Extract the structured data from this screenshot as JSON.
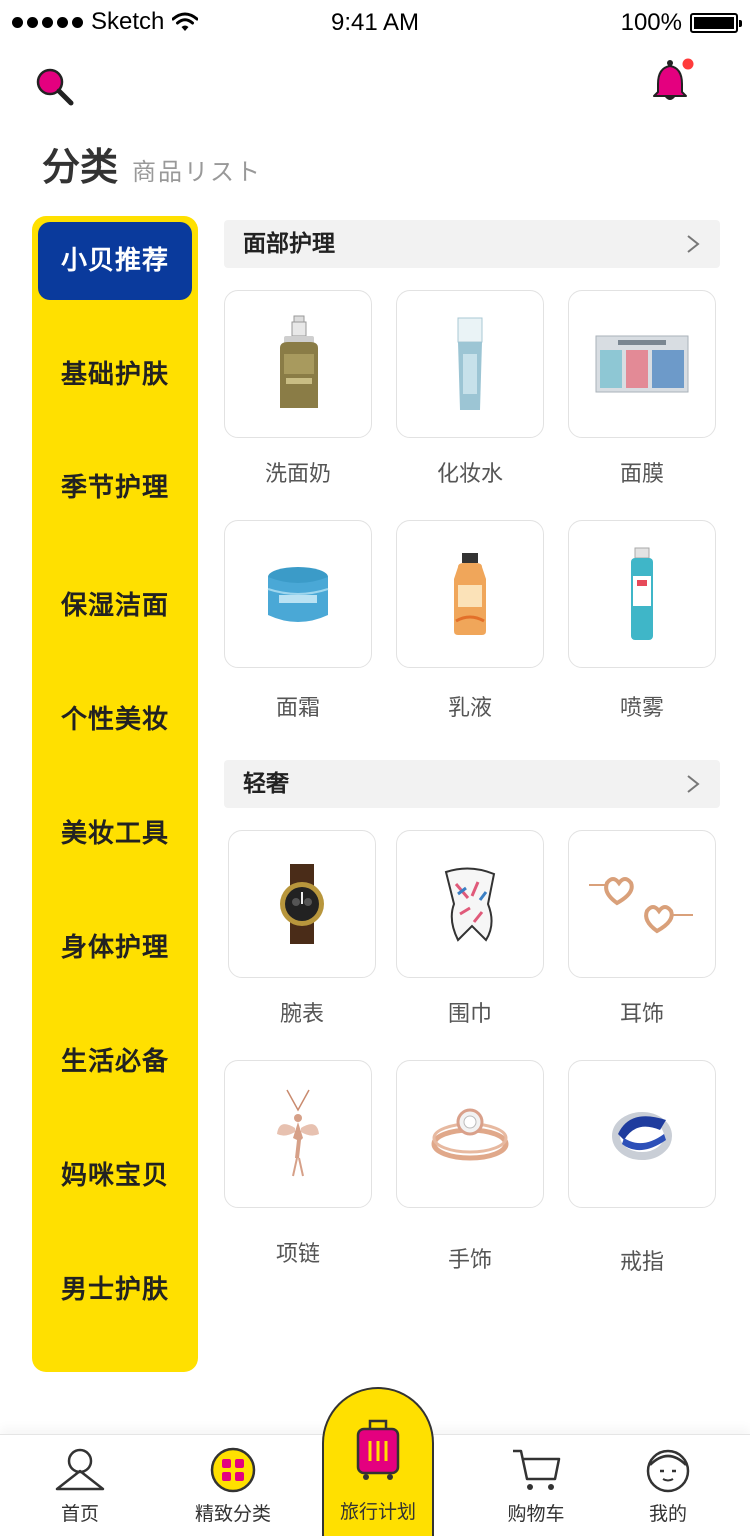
{
  "status_bar": {
    "carrier": "Sketch",
    "time": "9:41 AM",
    "battery": "100%"
  },
  "header": {
    "title": "分类",
    "subtitle": "商品リスト"
  },
  "sidebar": {
    "items": [
      {
        "label": "小贝推荐",
        "active": true
      },
      {
        "label": "基础护肤"
      },
      {
        "label": "季节护理"
      },
      {
        "label": "保湿洁面"
      },
      {
        "label": "个性美妆"
      },
      {
        "label": "美妆工具"
      },
      {
        "label": "身体护理"
      },
      {
        "label": "生活必备"
      },
      {
        "label": "妈咪宝贝"
      },
      {
        "label": "男士护肤"
      }
    ]
  },
  "sections": [
    {
      "title": "面部护理",
      "products": [
        {
          "label": "洗面奶",
          "icon": "cleanser-bottle-icon"
        },
        {
          "label": "化妆水",
          "icon": "toner-bottle-icon"
        },
        {
          "label": "面膜",
          "icon": "face-mask-pack-icon"
        },
        {
          "label": "面霜",
          "icon": "cream-jar-icon"
        },
        {
          "label": "乳液",
          "icon": "lotion-bottle-icon"
        },
        {
          "label": "喷雾",
          "icon": "spray-can-icon"
        }
      ]
    },
    {
      "title": "轻奢",
      "products": [
        {
          "label": "腕表",
          "icon": "wristwatch-icon"
        },
        {
          "label": "围巾",
          "icon": "scarf-icon"
        },
        {
          "label": "耳饰",
          "icon": "heart-earrings-icon"
        },
        {
          "label": "项链",
          "icon": "fairy-necklace-icon"
        },
        {
          "label": "手饰",
          "icon": "diamond-ring-icon"
        },
        {
          "label": "戒指",
          "icon": "sapphire-ring-icon"
        }
      ]
    }
  ],
  "tabbar": {
    "items": [
      {
        "label": "首页",
        "icon": "home-person-icon"
      },
      {
        "label": "精致分类",
        "icon": "category-grid-icon"
      },
      {
        "label": "旅行计划",
        "icon": "suitcase-icon"
      },
      {
        "label": "购物车",
        "icon": "cart-icon"
      },
      {
        "label": "我的",
        "icon": "profile-face-icon"
      }
    ]
  },
  "colors": {
    "accent_pink": "#e4007f",
    "sidebar_yellow": "#ffe000",
    "active_blue": "#0a3a9c",
    "notification_red": "#ff3b3b"
  }
}
